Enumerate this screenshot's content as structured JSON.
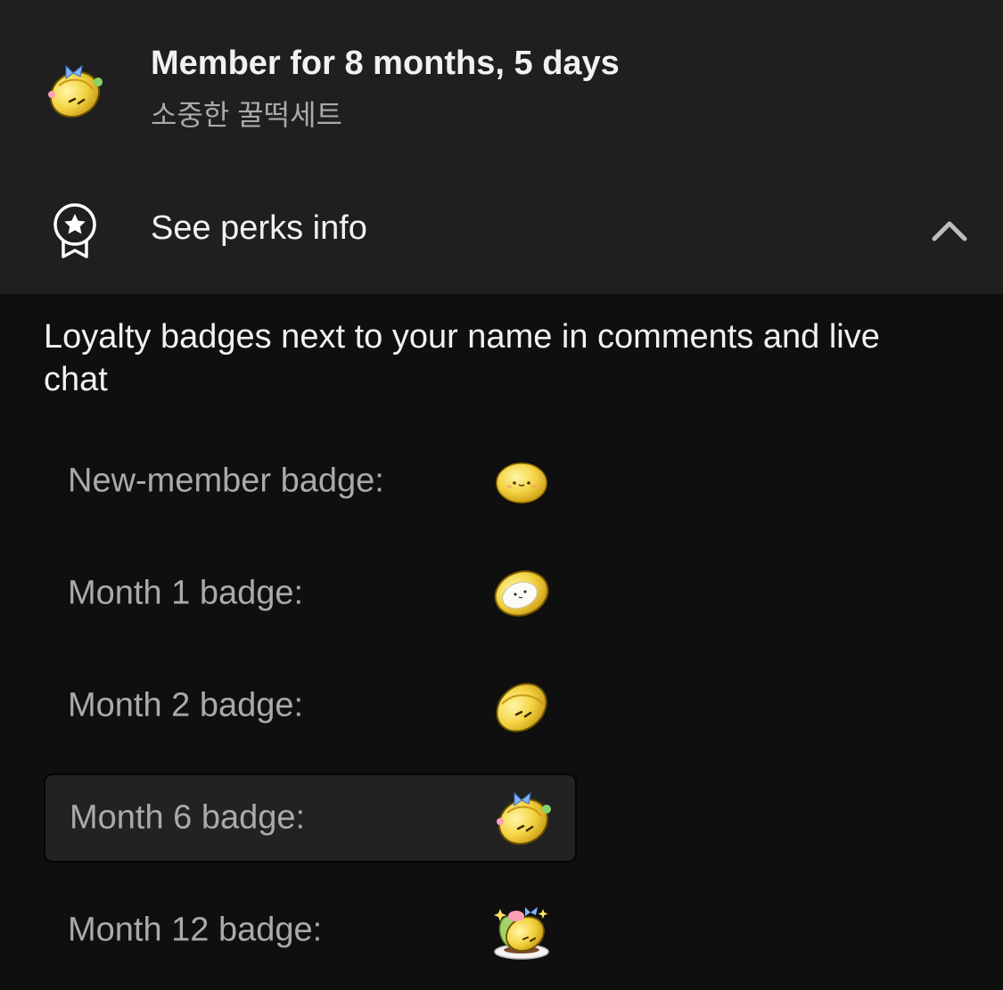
{
  "membership": {
    "title": "Member for 8 months, 5 days",
    "subtitle": "소중한 꿀떡세트",
    "avatar_icon": "month-6-badge-icon"
  },
  "perks": {
    "toggle_label": "See perks info",
    "expanded": true,
    "description": "Loyalty badges next to your name in comments and live chat",
    "badges": [
      {
        "label": "New-member badge:",
        "icon": "new-member-badge-icon",
        "selected": false
      },
      {
        "label": "Month 1 badge:",
        "icon": "month-1-badge-icon",
        "selected": false
      },
      {
        "label": "Month 2 badge:",
        "icon": "month-2-badge-icon",
        "selected": false
      },
      {
        "label": "Month 6 badge:",
        "icon": "month-6-badge-icon",
        "selected": true
      },
      {
        "label": "Month 12 badge:",
        "icon": "month-12-badge-icon",
        "selected": false
      }
    ]
  },
  "colors": {
    "background": "#0f0f0f",
    "header_background": "#1f1f1f",
    "selected_row": "#222222",
    "badge_yellow": "#f2d04a",
    "secondary_text": "#aaaaaa"
  }
}
